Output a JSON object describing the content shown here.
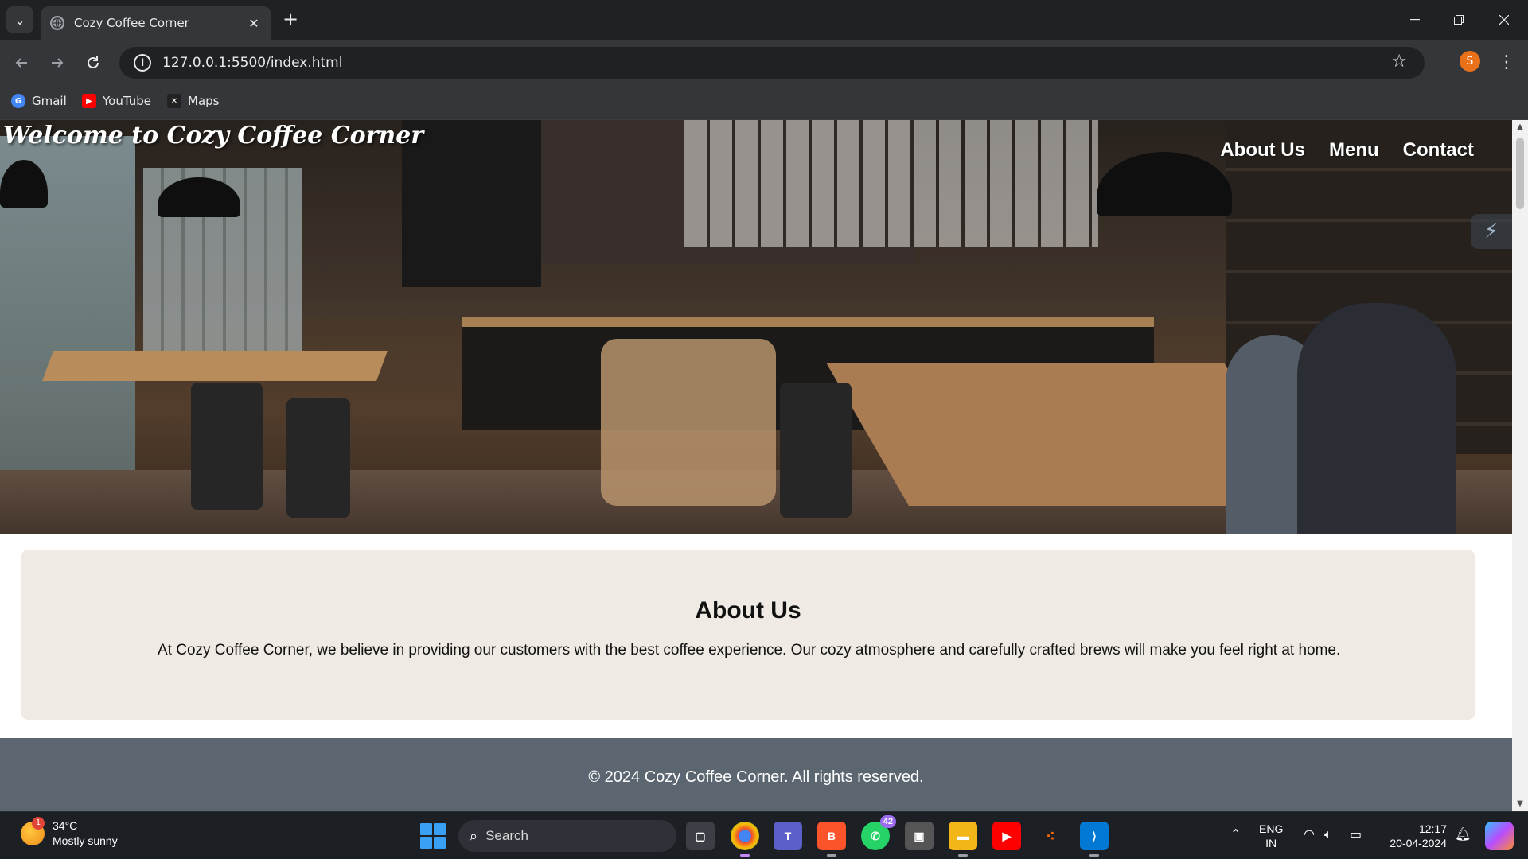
{
  "browser": {
    "tab_title": "Cozy Coffee Corner",
    "url": "127.0.0.1:5500/index.html",
    "profile_initial": "S",
    "bookmarks": [
      {
        "label": "Gmail",
        "icon": "google-icon",
        "color": "#4285f4"
      },
      {
        "label": "YouTube",
        "icon": "youtube-icon",
        "color": "#ff0000"
      },
      {
        "label": "Maps",
        "icon": "maps-icon",
        "color": "#222222"
      }
    ]
  },
  "site": {
    "title": "Welcome to Cozy Coffee Corner",
    "nav": [
      "About Us",
      "Menu",
      "Contact"
    ],
    "about": {
      "heading": "About Us",
      "text": "At Cozy Coffee Corner, we believe in providing our customers with the best coffee experience. Our cozy atmosphere and carefully crafted brews will make you feel right at home."
    },
    "footer": "© 2024 Cozy Coffee Corner. All rights reserved."
  },
  "taskbar": {
    "weather": {
      "temp": "34°C",
      "desc": "Mostly sunny",
      "badge": "1"
    },
    "search_label": "Search",
    "whatsapp_badge": "42",
    "language": {
      "lang": "ENG",
      "region": "IN"
    },
    "time": "12:17",
    "date": "20-04-2024"
  },
  "colors": {
    "about_bg": "#efebe4",
    "footer_bg": "#5b6670",
    "browser_dark": "#202124",
    "browser_toolbar": "#35363a"
  }
}
